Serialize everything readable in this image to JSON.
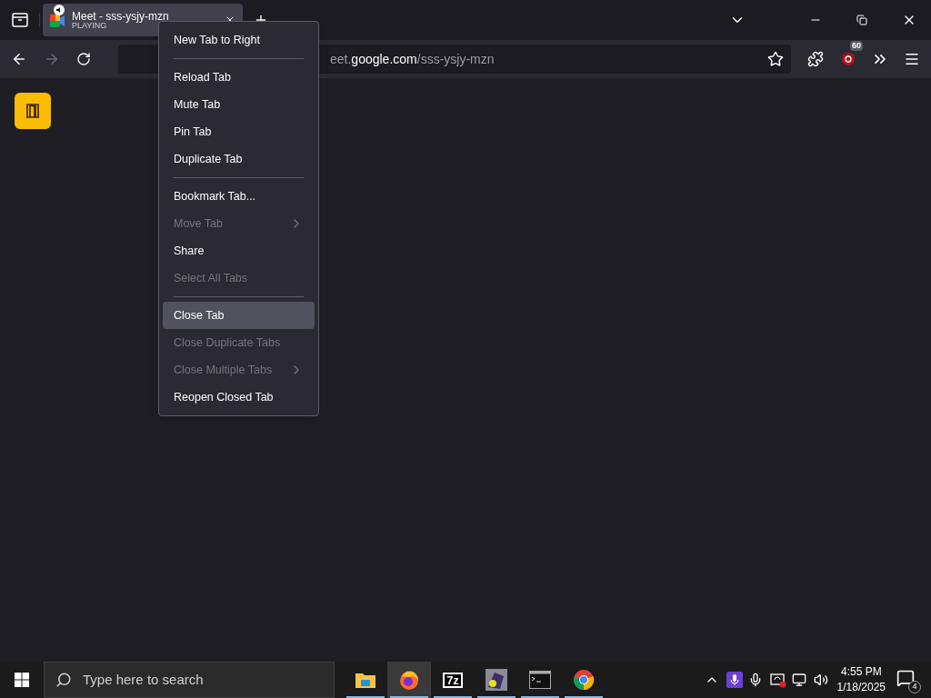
{
  "tabs": [
    {
      "title": "Meet - sss-ysjy-mzn",
      "status": "PLAYING",
      "selected": true,
      "playing": true
    }
  ],
  "url": {
    "host_prefix": "eet.",
    "domain": "google.com",
    "path": "/sss-ysjy-mzn"
  },
  "extension_badge": "60",
  "context_menu": [
    {
      "kind": "item",
      "label": "New Tab to Right",
      "disabled": false,
      "selected": false,
      "submenu": false
    },
    {
      "kind": "separator"
    },
    {
      "kind": "item",
      "label": "Reload Tab",
      "disabled": false,
      "selected": false,
      "submenu": false
    },
    {
      "kind": "item",
      "label": "Mute Tab",
      "disabled": false,
      "selected": false,
      "submenu": false
    },
    {
      "kind": "item",
      "label": "Pin Tab",
      "disabled": false,
      "selected": false,
      "submenu": false
    },
    {
      "kind": "item",
      "label": "Duplicate Tab",
      "disabled": false,
      "selected": false,
      "submenu": false
    },
    {
      "kind": "separator"
    },
    {
      "kind": "item",
      "label": "Bookmark Tab...",
      "disabled": false,
      "selected": false,
      "submenu": false
    },
    {
      "kind": "item",
      "label": "Move Tab",
      "disabled": true,
      "selected": false,
      "submenu": true
    },
    {
      "kind": "item",
      "label": "Share",
      "disabled": false,
      "selected": false,
      "submenu": false
    },
    {
      "kind": "item",
      "label": "Select All Tabs",
      "disabled": true,
      "selected": false,
      "submenu": false
    },
    {
      "kind": "separator"
    },
    {
      "kind": "item",
      "label": "Close Tab",
      "disabled": false,
      "selected": true,
      "submenu": false
    },
    {
      "kind": "item",
      "label": "Close Duplicate Tabs",
      "disabled": true,
      "selected": false,
      "submenu": false
    },
    {
      "kind": "item",
      "label": "Close Multiple Tabs",
      "disabled": true,
      "selected": false,
      "submenu": true
    },
    {
      "kind": "item",
      "label": "Reopen Closed Tab",
      "disabled": false,
      "selected": false,
      "submenu": false
    }
  ],
  "taskbar": {
    "search_placeholder": "Type here to search",
    "apps": [
      {
        "kind": "files",
        "running": true,
        "selected": false
      },
      {
        "kind": "firefox",
        "running": true,
        "selected": true
      },
      {
        "kind": "archiver",
        "label": "7z",
        "running": true,
        "selected": false
      },
      {
        "kind": "app",
        "running": true,
        "selected": false
      },
      {
        "kind": "terminal",
        "running": true,
        "selected": false
      },
      {
        "kind": "chrome",
        "running": true,
        "selected": false
      }
    ],
    "time": "4:55 PM",
    "date": "1/18/2025",
    "notification_count": "4"
  }
}
